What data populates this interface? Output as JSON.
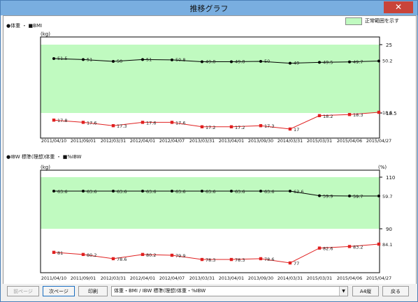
{
  "window": {
    "title": "推移グラフ",
    "close_glyph": "✕"
  },
  "legend": {
    "normal_range": "正常範囲を示す"
  },
  "chart1": {
    "section_label": "●体重 ・ ■BMI",
    "left_unit": "(kg)"
  },
  "chart2": {
    "section_label": "●IBW 標準(理想)体重 ・ ■%IBW",
    "left_unit": "(kg)",
    "right_unit": "(%)"
  },
  "footer": {
    "prev_label": "前ページ",
    "next_label": "次ページ",
    "print_label": "印刷",
    "select_value": "体重・BMI / IBW 標準(理想)体重・%IBW",
    "paper_label": "A4縦",
    "back_label": "戻る"
  },
  "chart_data": [
    {
      "type": "line",
      "x": [
        "2011/04/10",
        "2011/09/01",
        "2012/03/31",
        "2012/04/01",
        "2012/04/07",
        "2013/03/31",
        "2013/04/01",
        "2013/09/30",
        "2014/03/31",
        "2015/03/31",
        "2015/04/06",
        "2015/04/27"
      ],
      "series": [
        {
          "name": "体重",
          "color": "#000000",
          "marker": "circle",
          "values": [
            51.5,
            51,
            50,
            51,
            50.8,
            49.8,
            49.8,
            50,
            49,
            49.5,
            49.7,
            50.2
          ]
        },
        {
          "name": "BMI",
          "color": "#e02020",
          "marker": "square",
          "values": [
            17.8,
            17.6,
            17.3,
            17.6,
            17.6,
            17.2,
            17.2,
            17.3,
            17,
            18.2,
            18.3,
            18.5
          ]
        }
      ],
      "right_axis_ticks": [
        "25",
        "18.5"
      ],
      "normal_range_band": [
        18.5,
        25
      ],
      "grid": false
    },
    {
      "type": "line",
      "x": [
        "2011/04/10",
        "2011/09/01",
        "2012/03/31",
        "2012/04/01",
        "2012/04/07",
        "2013/03/31",
        "2013/04/01",
        "2013/09/30",
        "2014/03/31",
        "2015/03/31",
        "2015/04/06",
        "2015/04/27"
      ],
      "series": [
        {
          "name": "IBW 標準(理想)体重",
          "color": "#000000",
          "marker": "circle",
          "values": [
            63.6,
            63.6,
            63.6,
            63.6,
            63.6,
            63.6,
            63.6,
            63.6,
            63.6,
            59.9,
            59.7,
            59.7
          ]
        },
        {
          "name": "%IBW",
          "color": "#e02020",
          "marker": "square",
          "values": [
            81,
            80.2,
            78.6,
            80.2,
            79.9,
            78.3,
            78.3,
            78.6,
            77,
            82.6,
            83.2,
            84.1
          ]
        }
      ],
      "right_axis_ticks": [
        "110",
        "90"
      ],
      "normal_range_band": [
        90,
        110
      ],
      "grid": false
    }
  ]
}
